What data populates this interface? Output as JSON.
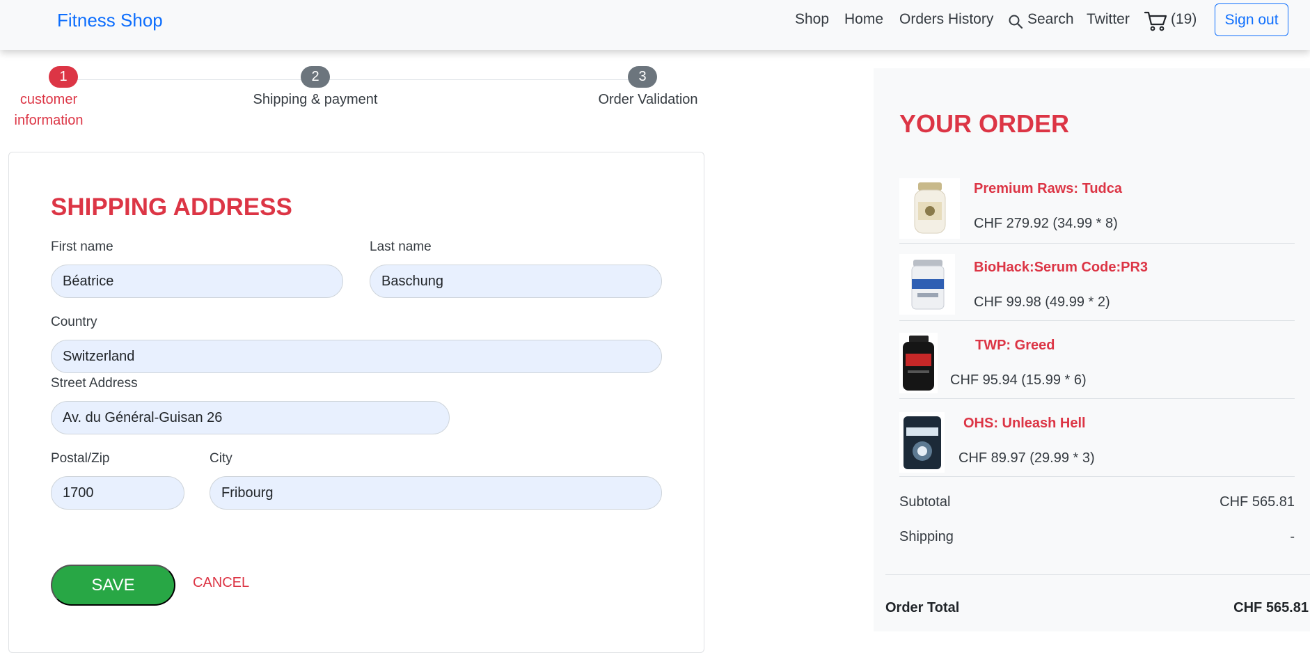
{
  "navbar": {
    "brand": "Fitness Shop",
    "links": [
      "Shop",
      "Home",
      "Orders History"
    ],
    "search_label": "Search",
    "twitter_label": "Twitter",
    "cart_count": "(19)",
    "signout_label": "Sign out",
    "brand_color": "#0d6efd"
  },
  "stepper": {
    "steps": [
      {
        "number": "1",
        "label_line1": "customer",
        "label_line2": "information",
        "active": true
      },
      {
        "number": "2",
        "label_line1": "Shipping & payment",
        "active": false
      },
      {
        "number": "3",
        "label_line1": "Order Validation",
        "active": false
      }
    ],
    "active_color": "#dc3545",
    "inactive_color": "#6c757d"
  },
  "form": {
    "title": "SHIPPING ADDRESS",
    "first_name": {
      "label": "First name",
      "value": "Béatrice"
    },
    "last_name": {
      "label": "Last name",
      "value": "Baschung"
    },
    "country": {
      "label": "Country",
      "value": "Switzerland"
    },
    "street": {
      "label": "Street Address",
      "value": "Av. du Général-Guisan 26"
    },
    "postal": {
      "label": "Postal/Zip",
      "value": "1700"
    },
    "city": {
      "label": "City",
      "value": "Fribourg"
    },
    "save_label": "SAVE",
    "cancel_label": "CANCEL"
  },
  "order": {
    "title": "YOUR ORDER",
    "items": [
      {
        "name": "Premium Raws: Tudca",
        "price": "CHF 279.92 (34.99 * 8)",
        "icon": "supplement-bottle-white"
      },
      {
        "name": "BioHack:Serum Code:PR3",
        "price": "CHF 99.98 (49.99 * 2)",
        "icon": "supplement-tub-white"
      },
      {
        "name": "TWP: Greed",
        "price": "CHF 95.94 (15.99 * 6)",
        "icon": "supplement-bottle-black"
      },
      {
        "name": "OHS: Unleash Hell",
        "price": "CHF 89.97 (29.99 * 3)",
        "icon": "supplement-tub-dark"
      }
    ],
    "subtotal_label": "Subtotal",
    "subtotal_value": "CHF 565.81",
    "shipping_label": "Shipping",
    "shipping_value": "-",
    "total_label": "Order Total",
    "total_value": "CHF 565.81"
  },
  "colors": {
    "accent": "#dc3545",
    "save": "#28a745",
    "input_bg": "#e8f0fe"
  }
}
